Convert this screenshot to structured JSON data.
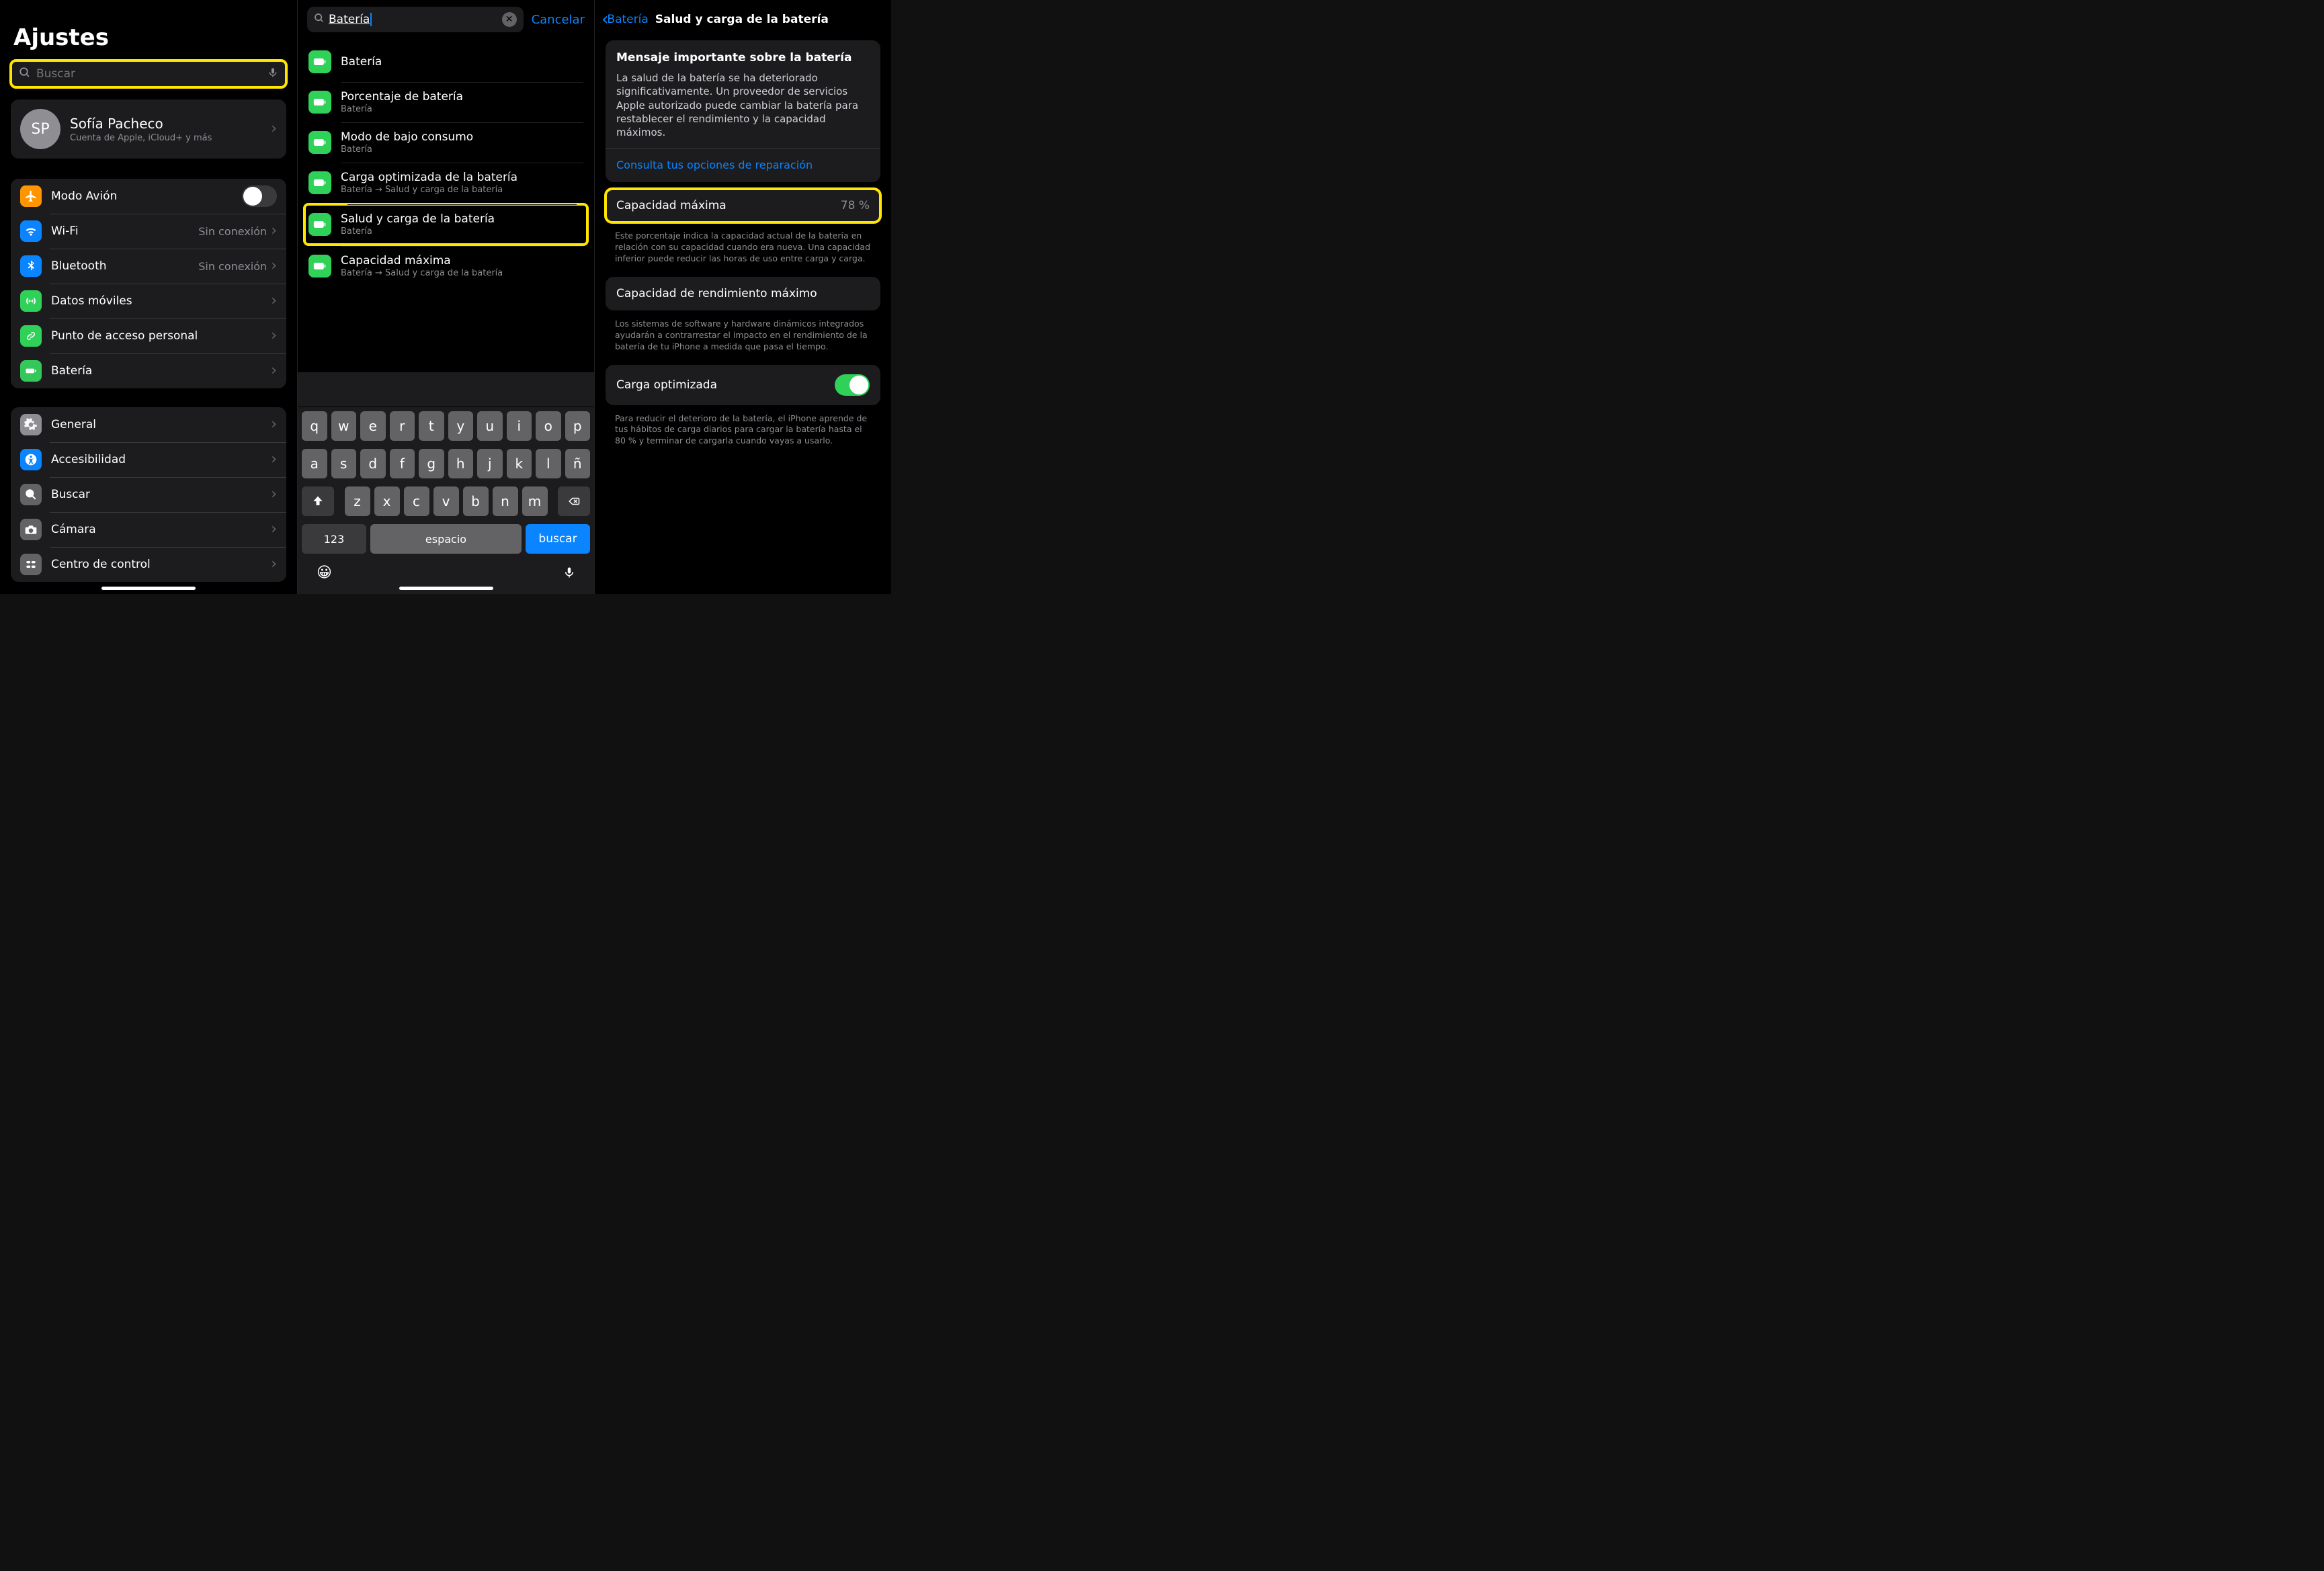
{
  "pane1": {
    "title": "Ajustes",
    "search_placeholder": "Buscar",
    "account": {
      "initials": "SP",
      "name": "Sofía Pacheco",
      "sub": "Cuenta de Apple, iCloud+ y más"
    },
    "groupA": [
      {
        "icon": "airplane",
        "color": "ic-orange",
        "label": "Modo Avión",
        "kind": "toggle",
        "on": false
      },
      {
        "icon": "wifi",
        "color": "ic-blue",
        "label": "Wi-Fi",
        "value": "Sin conexión"
      },
      {
        "icon": "bluetooth",
        "color": "ic-blue",
        "label": "Bluetooth",
        "value": "Sin conexión"
      },
      {
        "icon": "antenna",
        "color": "ic-green2",
        "label": "Datos móviles"
      },
      {
        "icon": "link",
        "color": "ic-green2",
        "label": "Punto de acceso personal"
      },
      {
        "icon": "battery",
        "color": "ic-green3",
        "label": "Batería"
      }
    ],
    "groupB": [
      {
        "icon": "gear",
        "color": "ic-gray",
        "label": "General"
      },
      {
        "icon": "accessibility",
        "color": "ic-blue",
        "label": "Accesibilidad"
      },
      {
        "icon": "search",
        "color": "ic-dgray",
        "label": "Buscar"
      },
      {
        "icon": "camera",
        "color": "ic-dgray",
        "label": "Cámara"
      },
      {
        "icon": "control",
        "color": "ic-dgray",
        "label": "Centro de control"
      }
    ]
  },
  "pane2": {
    "query": "Batería",
    "cancel": "Cancelar",
    "results": [
      {
        "title": "Batería",
        "sub": ""
      },
      {
        "title": "Porcentaje de batería",
        "sub": "Batería"
      },
      {
        "title": "Modo de bajo consumo",
        "sub": "Batería"
      },
      {
        "title": "Carga optimizada de la batería",
        "sub": "Batería → Salud y carga de la batería"
      },
      {
        "title": "Salud y carga de la batería",
        "sub": "Batería",
        "hl": true
      },
      {
        "title": "Capacidad máxima",
        "sub": "Batería → Salud y carga de la batería"
      }
    ],
    "keys_r1": [
      "q",
      "w",
      "e",
      "r",
      "t",
      "y",
      "u",
      "i",
      "o",
      "p"
    ],
    "keys_r2": [
      "a",
      "s",
      "d",
      "f",
      "g",
      "h",
      "j",
      "k",
      "l",
      "ñ"
    ],
    "keys_r3": [
      "z",
      "x",
      "c",
      "v",
      "b",
      "n",
      "m"
    ],
    "k123": "123",
    "kspace": "espacio",
    "kgo": "buscar"
  },
  "pane3": {
    "back": "Batería",
    "title": "Salud y carga de la batería",
    "msg_title": "Mensaje importante sobre la batería",
    "msg_body": "La salud de la batería se ha deteriorado significativamente. Un proveedor de servicios Apple autorizado puede cambiar la batería para restablecer el rendimiento y la capacidad máximos.",
    "msg_link": "Consulta tus opciones de reparación",
    "cap_label": "Capacidad máxima",
    "cap_value": "78 %",
    "cap_foot": "Este porcentaje indica la capacidad actual de la batería en relación con su capacidad cuando era nueva. Una capacidad inferior puede reducir las horas de uso entre carga y carga.",
    "perf_label": "Capacidad de rendimiento máximo",
    "perf_foot": "Los sistemas de software y hardware dinámicos integrados ayudarán a contrarrestar el impacto en el rendimiento de la batería de tu iPhone a medida que pasa el tiempo.",
    "opt_label": "Carga optimizada",
    "opt_on": true,
    "opt_foot": "Para reducir el deterioro de la batería, el iPhone aprende de tus hábitos de carga diarios para cargar la batería hasta el 80 % y terminar de cargarla cuando vayas a usarlo."
  }
}
